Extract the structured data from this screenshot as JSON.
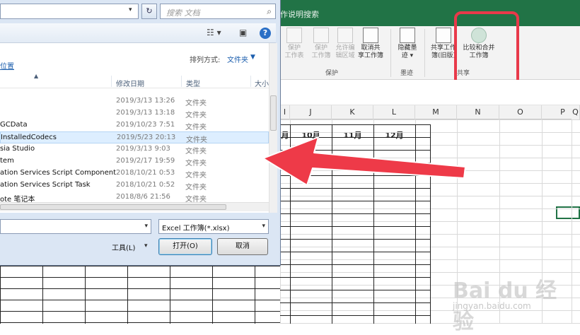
{
  "ribbon": {
    "tell_me": "作说明搜索",
    "buttons": [
      {
        "label": "保护\n工作表",
        "dim": true
      },
      {
        "label": "保护\n工作簿",
        "dim": true
      },
      {
        "label": "允许编\n辑区域",
        "dim": true
      },
      {
        "label": "取消共\n享工作簿",
        "dim": false
      },
      {
        "label": "隐藏墨\n迹 ▾",
        "dim": false
      },
      {
        "label": "共享工作\n簿(旧版)",
        "dim": false
      },
      {
        "label": "比较和合并\n工作簿",
        "dim": false
      }
    ],
    "groups": {
      "protect": "保护",
      "ink": "墨迹",
      "share": "共享"
    },
    "highlight_color": "#e8394a",
    "accent": "#217346"
  },
  "sheet": {
    "columns": [
      "I",
      "J",
      "K",
      "L",
      "M",
      "N",
      "O",
      "P",
      "Q"
    ],
    "months": [
      "月",
      "10月",
      "11月",
      "12月"
    ]
  },
  "dialog": {
    "search_placeholder": "搜索 文档",
    "library_link": "位置",
    "sort_label": "排列方式:",
    "sort_value": "文件夹",
    "headers": {
      "date": "修改日期",
      "type": "类型",
      "size": "大小"
    },
    "files": [
      {
        "name": "",
        "date": "2019/3/13 13:26",
        "type": "文件夹"
      },
      {
        "name": "",
        "date": "2019/3/13 13:18",
        "type": "文件夹"
      },
      {
        "name": "GCData",
        "date": "2019/10/23 7:51",
        "type": "文件夹"
      },
      {
        "name": "InstalledCodecs",
        "date": "2019/5/23 20:13",
        "type": "文件夹",
        "selected": true
      },
      {
        "name": "sia Studio",
        "date": "2019/3/13 9:03",
        "type": "文件夹"
      },
      {
        "name": "tem",
        "date": "2019/2/17 19:59",
        "type": "文件夹"
      },
      {
        "name": "ation Services Script Component",
        "date": "2018/10/21 0:53",
        "type": "文件夹"
      },
      {
        "name": "ation Services Script Task",
        "date": "2018/10/21 0:52",
        "type": "文件夹"
      },
      {
        "name": "ote 笔记本",
        "date": "2018/8/6 21:56",
        "type": "文件夹"
      }
    ],
    "filetype": "Excel 工作簿(*.xlsx)",
    "tools": "工具(L)",
    "open": "打开(O)",
    "cancel": "取消"
  },
  "watermark": {
    "text": "Bai du 经验",
    "url": "jingyan.baidu.com"
  }
}
